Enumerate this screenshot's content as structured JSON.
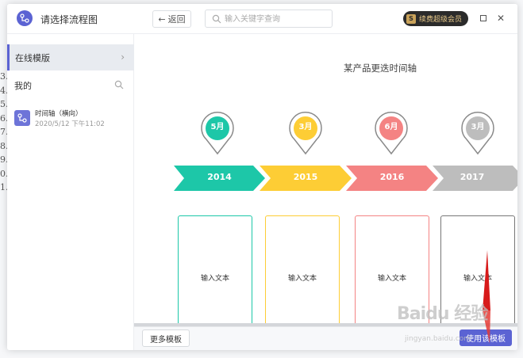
{
  "window": {
    "title": "请选择流程图",
    "back_label": "返回",
    "search_placeholder": "输入关键字查询",
    "vip_label": "续费超级会员",
    "maximize_icon": "square-icon",
    "close_icon": "close-icon"
  },
  "background": {
    "row_numbers": [
      "3.",
      "4.",
      "5.",
      "6.",
      "7.",
      "8.",
      "9.",
      "0.",
      "1."
    ]
  },
  "sidebar": {
    "online_label": "在线模版",
    "mine_label": "我的",
    "files": [
      {
        "name": "时间轴（横向）",
        "date": "2020/5/12 下午11:02"
      }
    ]
  },
  "preview": {
    "title": "某产品更迭时间轴",
    "milestones": [
      {
        "month": "5月",
        "year": "2014",
        "color": "#1dc7a8",
        "text": "输入文本"
      },
      {
        "month": "3月",
        "year": "2015",
        "color": "#fdcd35",
        "text": "输入文本"
      },
      {
        "month": "6月",
        "year": "2016",
        "color": "#f48383",
        "text": "输入文本"
      },
      {
        "month": "3月",
        "year": "2017",
        "color": "#bdbdbd",
        "text": "输入文本"
      }
    ]
  },
  "footer": {
    "more_label": "更多模板",
    "use_label": "使用该模板"
  },
  "watermark": {
    "brand": "Baidu 经验",
    "url": "jingyan.baidu.com"
  },
  "colors": {
    "accent": "#5b63d3",
    "sidebar_active_bg": "#e8ebf0"
  }
}
